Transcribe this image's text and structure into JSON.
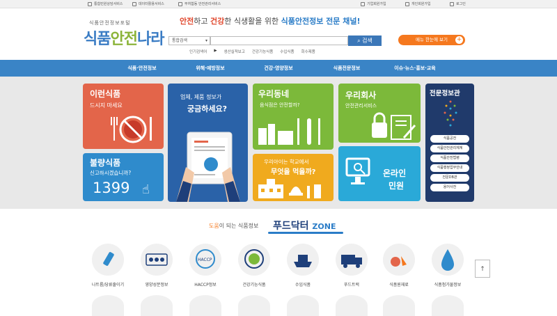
{
  "topbar": {
    "left": [
      "통합민원상담서비스",
      "데이터활용서비스",
      "부처합동 안전관리서비스"
    ],
    "right": [
      "기업회원가입",
      "개인회원가입",
      "로그인"
    ]
  },
  "header": {
    "logo_sub": "식품안전정보포털",
    "logo_a": "식품",
    "logo_b": "안전",
    "logo_c": "나라",
    "tagline": {
      "p1": "안전",
      "p2": "하고 ",
      "p3": "건강",
      "p4": "한 식생활을 위한 ",
      "p5": "식품안전정보 전문 채널!"
    },
    "search_select": "통합검색",
    "search_button": "검색",
    "quick_label": "인기검색어",
    "quick_links": [
      "생산실적보고",
      "건강기능식품",
      "수입식품",
      "회수제품"
    ],
    "menu_button": "메뉴 한눈에 보기"
  },
  "nav": [
    "식품·안전정보",
    "위해·예방정보",
    "건강·영양정보",
    "식품전문정보",
    "이슈·뉴스·홍보·교육"
  ],
  "tiles": {
    "t1": {
      "title": "이런식품",
      "sub": "드시지 마세요"
    },
    "t2": {
      "title": "불량식품",
      "sub": "신고하시겠습니까?",
      "num": "1399"
    },
    "t3": {
      "line1": "업체, 제품 정보가",
      "line2": "궁금하세요?"
    },
    "t4": {
      "title": "우리동네",
      "sub": "음식점은 안전할까?"
    },
    "t5": {
      "line1": "우리아이는 학교에서",
      "line2": "무엇을 먹을까?"
    },
    "t6": {
      "title": "우리회사",
      "sub": "안전관리서비스"
    },
    "t7": {
      "title": "온라인",
      "sub": "민원"
    },
    "t8": {
      "title": "전문정보관",
      "buttons": [
        "식품공전",
        "식품안전관리체계",
        "식품안전법령",
        "식품행정업무안내",
        "전문DB관",
        "용어사전"
      ]
    }
  },
  "fd": {
    "pre1": "도움",
    "pre2": "이 되는 식품정보",
    "brand": "푸드닥터",
    "zone": "ZONE"
  },
  "icons": [
    {
      "label": "나트륨/당류줄이기",
      "icon": "salt-shaker-icon"
    },
    {
      "label": "영양성분정보",
      "icon": "nutrition-icon"
    },
    {
      "label": "HACCP정보",
      "icon": "haccp-icon"
    },
    {
      "label": "건강기능식품",
      "icon": "health-food-icon"
    },
    {
      "label": "수입식품",
      "icon": "ship-icon"
    },
    {
      "label": "푸드트럭",
      "icon": "truck-icon"
    },
    {
      "label": "식품원재료",
      "icon": "ingredient-icon"
    },
    {
      "label": "식품첨가물정보",
      "icon": "additive-icon"
    }
  ],
  "totop": "↑"
}
